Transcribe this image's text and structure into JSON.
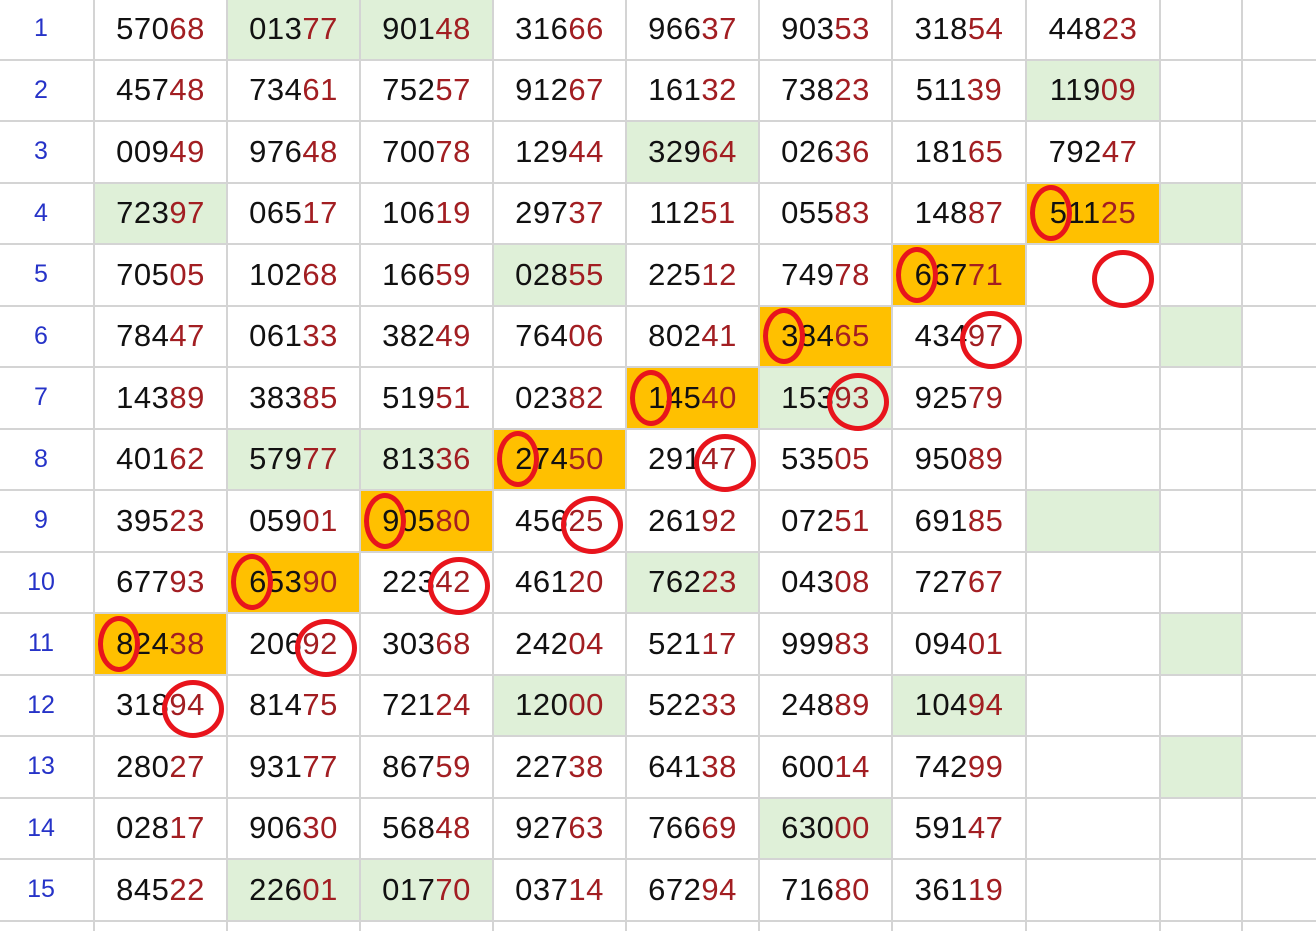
{
  "colors": {
    "green": "#dff0d8",
    "orange": "#ffc000",
    "text": "#111111",
    "accent_digits": "#a21e22",
    "row_number": "#2633c8",
    "marker": "#e8141c"
  },
  "rows": [
    {
      "n": "1",
      "cells": [
        "57068",
        "01377",
        "90148",
        "31666",
        "96637",
        "90353",
        "31854",
        "44823"
      ],
      "hl": [
        "",
        "g",
        "g",
        "",
        "",
        "",
        "",
        ""
      ]
    },
    {
      "n": "2",
      "cells": [
        "45748",
        "73461",
        "75257",
        "91267",
        "16132",
        "73823",
        "51139",
        "11909"
      ],
      "hl": [
        "",
        "",
        "",
        "",
        "",
        "",
        "",
        "g"
      ]
    },
    {
      "n": "3",
      "cells": [
        "00949",
        "97648",
        "70078",
        "12944",
        "32964",
        "02636",
        "18165",
        "79247"
      ],
      "hl": [
        "",
        "",
        "",
        "",
        "g",
        "",
        "",
        ""
      ]
    },
    {
      "n": "4",
      "cells": [
        "72397",
        "06517",
        "10619",
        "29737",
        "11251",
        "05583",
        "14887",
        "51125"
      ],
      "hl": [
        "g",
        "",
        "",
        "",
        "",
        "",
        "",
        "o"
      ]
    },
    {
      "n": "5",
      "cells": [
        "70505",
        "10268",
        "16659",
        "02855",
        "22512",
        "74978",
        "66771",
        ""
      ],
      "hl": [
        "",
        "",
        "",
        "g",
        "",
        "",
        "o",
        ""
      ]
    },
    {
      "n": "6",
      "cells": [
        "78447",
        "06133",
        "38249",
        "76406",
        "80241",
        "38465",
        "43497",
        ""
      ],
      "hl": [
        "",
        "",
        "",
        "",
        "",
        "o",
        "",
        ""
      ]
    },
    {
      "n": "7",
      "cells": [
        "14389",
        "38385",
        "51951",
        "02382",
        "14540",
        "15393",
        "92579",
        ""
      ],
      "hl": [
        "",
        "",
        "",
        "",
        "o",
        "g",
        "",
        ""
      ]
    },
    {
      "n": "8",
      "cells": [
        "40162",
        "57977",
        "81336",
        "27450",
        "29147",
        "53505",
        "95089",
        ""
      ],
      "hl": [
        "",
        "g",
        "g",
        "o",
        "",
        "",
        "",
        ""
      ]
    },
    {
      "n": "9",
      "cells": [
        "39523",
        "05901",
        "90580",
        "45625",
        "26192",
        "07251",
        "69185",
        ""
      ],
      "hl": [
        "",
        "",
        "o",
        "",
        "",
        "",
        "",
        ""
      ]
    },
    {
      "n": "10",
      "cells": [
        "67793",
        "65390",
        "22342",
        "46120",
        "76223",
        "04308",
        "72767",
        ""
      ],
      "hl": [
        "",
        "o",
        "",
        "",
        "g",
        "",
        "",
        ""
      ]
    },
    {
      "n": "11",
      "cells": [
        "82438",
        "20692",
        "30368",
        "24204",
        "52117",
        "99983",
        "09401",
        ""
      ],
      "hl": [
        "o",
        "",
        "",
        "",
        "",
        "",
        "",
        ""
      ]
    },
    {
      "n": "12",
      "cells": [
        "31894",
        "81475",
        "72124",
        "12000",
        "52233",
        "24889",
        "10494",
        ""
      ],
      "hl": [
        "",
        "",
        "",
        "g",
        "",
        "",
        "g",
        ""
      ]
    },
    {
      "n": "13",
      "cells": [
        "28027",
        "93177",
        "86759",
        "22738",
        "64138",
        "60014",
        "74299",
        ""
      ],
      "hl": [
        "",
        "",
        "",
        "",
        "",
        "",
        "",
        ""
      ]
    },
    {
      "n": "14",
      "cells": [
        "02817",
        "90630",
        "56848",
        "92763",
        "76669",
        "63000",
        "59147",
        ""
      ],
      "hl": [
        "",
        "",
        "",
        "",
        "",
        "g",
        "",
        ""
      ]
    },
    {
      "n": "15",
      "cells": [
        "84522",
        "22601",
        "01770",
        "03714",
        "67294",
        "71680",
        "36119",
        ""
      ],
      "hl": [
        "",
        "g",
        "g",
        "",
        "",
        "",
        "",
        ""
      ]
    }
  ],
  "extra_green": [
    {
      "col": 9,
      "row": 4
    },
    {
      "col": 8,
      "row": 9
    },
    {
      "col": 9,
      "row": 6
    },
    {
      "col": 9,
      "row": 11
    },
    {
      "col": 9,
      "row": 13
    }
  ],
  "markers": [
    {
      "row": 4,
      "col": 8,
      "digit": 0
    },
    {
      "row": 5,
      "col": 7,
      "digit": 0
    },
    {
      "row": 6,
      "col": 6,
      "digit": 0
    },
    {
      "row": 7,
      "col": 5,
      "digit": 0
    },
    {
      "row": 8,
      "col": 4,
      "digit": 0
    },
    {
      "row": 9,
      "col": 3,
      "digit": 0
    },
    {
      "row": 10,
      "col": 2,
      "digit": 0
    },
    {
      "row": 11,
      "col": 1,
      "digit": 0
    },
    {
      "row": 5,
      "col": 8,
      "digit": 4
    },
    {
      "row": 6,
      "col": 7,
      "digit": 4
    },
    {
      "row": 7,
      "col": 6,
      "digit": 4
    },
    {
      "row": 8,
      "col": 5,
      "digit": 4
    },
    {
      "row": 9,
      "col": 4,
      "digit": 4
    },
    {
      "row": 10,
      "col": 3,
      "digit": 4
    },
    {
      "row": 11,
      "col": 2,
      "digit": 4
    },
    {
      "row": 12,
      "col": 1,
      "digit": 4
    }
  ]
}
